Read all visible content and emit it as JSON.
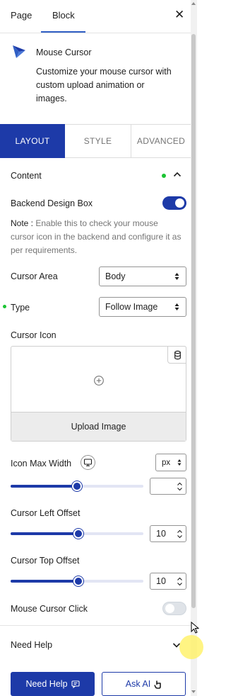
{
  "header": {
    "tabs": [
      {
        "label": "Page"
      },
      {
        "label": "Block"
      }
    ],
    "close_icon": "close-icon"
  },
  "widget": {
    "title": "Mouse Cursor",
    "description": "Customize your mouse cursor with custom upload animation or images.",
    "icon": "cursor-logo-icon"
  },
  "section_tabs": [
    {
      "label": "LAYOUT"
    },
    {
      "label": "STYLE"
    },
    {
      "label": "ADVANCED"
    }
  ],
  "content": {
    "heading": "Content",
    "backend_design_box": {
      "label": "Backend Design Box",
      "enabled": true
    },
    "note_prefix": "Note :",
    "note_text": " Enable this to check your mouse cursor icon in the backend and configure it as per requirements.",
    "cursor_area": {
      "label": "Cursor Area",
      "value": "Body"
    },
    "type": {
      "label": "Type",
      "value": "Follow Image"
    },
    "cursor_icon": {
      "label": "Cursor Icon",
      "upload_label": "Upload Image"
    },
    "icon_max_width": {
      "label": "Icon Max Width",
      "unit": "px",
      "value": "",
      "slider_fraction": 0.5
    },
    "cursor_left_offset": {
      "label": "Cursor Left Offset",
      "value": "10",
      "slider_fraction": 0.51
    },
    "cursor_top_offset": {
      "label": "Cursor Top Offset",
      "value": "10",
      "slider_fraction": 0.51
    },
    "mouse_cursor_click": {
      "label": "Mouse Cursor Click",
      "enabled": false
    }
  },
  "help": {
    "heading": "Need Help",
    "need_help_button": "Need Help",
    "ask_ai_button": "Ask AI"
  },
  "colors": {
    "accent": "#1d3aa8",
    "status_dot": "#1bc433"
  }
}
